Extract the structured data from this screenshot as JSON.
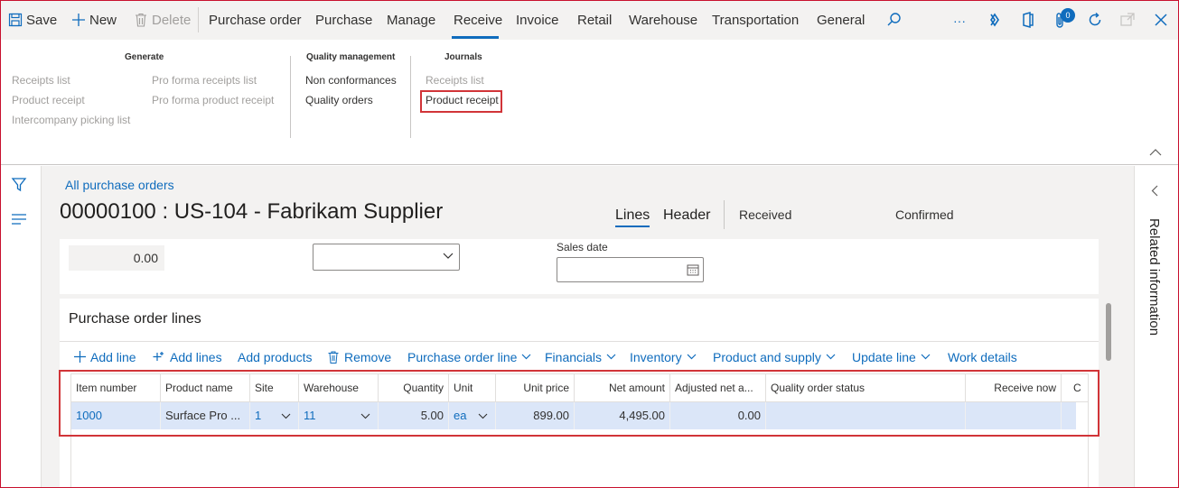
{
  "toolbar": {
    "save": "Save",
    "new": "New",
    "delete": "Delete",
    "tabs": [
      "Purchase order",
      "Purchase",
      "Manage",
      "Receive",
      "Invoice",
      "Retail",
      "Warehouse",
      "Transportation",
      "General"
    ],
    "active_tab": "Receive",
    "notification_count": "0",
    "more": "···"
  },
  "ribbon": {
    "generate": {
      "title": "Generate",
      "col1": [
        "Receipts list",
        "Product receipt",
        "Intercompany picking list"
      ],
      "col2": [
        "Pro forma receipts list",
        "Pro forma product receipt"
      ]
    },
    "quality": {
      "title": "Quality management",
      "items": [
        "Non conformances",
        "Quality orders"
      ]
    },
    "journals": {
      "title": "Journals",
      "items": [
        "Receipts list",
        "Product receipt"
      ]
    }
  },
  "page": {
    "breadcrumb": "All purchase orders",
    "title": "00000100 : US-104 - Fabrikam Supplier",
    "view_tabs": [
      "Lines",
      "Header"
    ],
    "status1": "Received",
    "status2": "Confirmed"
  },
  "header_fields": {
    "amount": "0.00",
    "sales_date_label": "Sales date"
  },
  "lines": {
    "title": "Purchase order lines",
    "actions": [
      "Add line",
      "Add lines",
      "Add products",
      "Remove",
      "Purchase order line",
      "Financials",
      "Inventory",
      "Product and supply",
      "Update line",
      "Work details"
    ],
    "columns": [
      "Item number",
      "Product name",
      "Site",
      "Warehouse",
      "Quantity",
      "Unit",
      "Unit price",
      "Net amount",
      "Adjusted net a...",
      "Quality order status",
      "Receive now",
      "C"
    ],
    "rows": [
      {
        "item": "1000",
        "product": "Surface Pro ...",
        "site": "1",
        "warehouse": "11",
        "quantity": "5.00",
        "unit": "ea",
        "unit_price": "899.00",
        "net_amount": "4,495.00",
        "adjusted": "0.00",
        "quality": "",
        "receive_now": ""
      }
    ]
  },
  "related": {
    "label": "Related information"
  },
  "colors": {
    "accent": "#0f6cbd",
    "highlight": "#d13438",
    "selected_row": "#dbe6f8"
  }
}
